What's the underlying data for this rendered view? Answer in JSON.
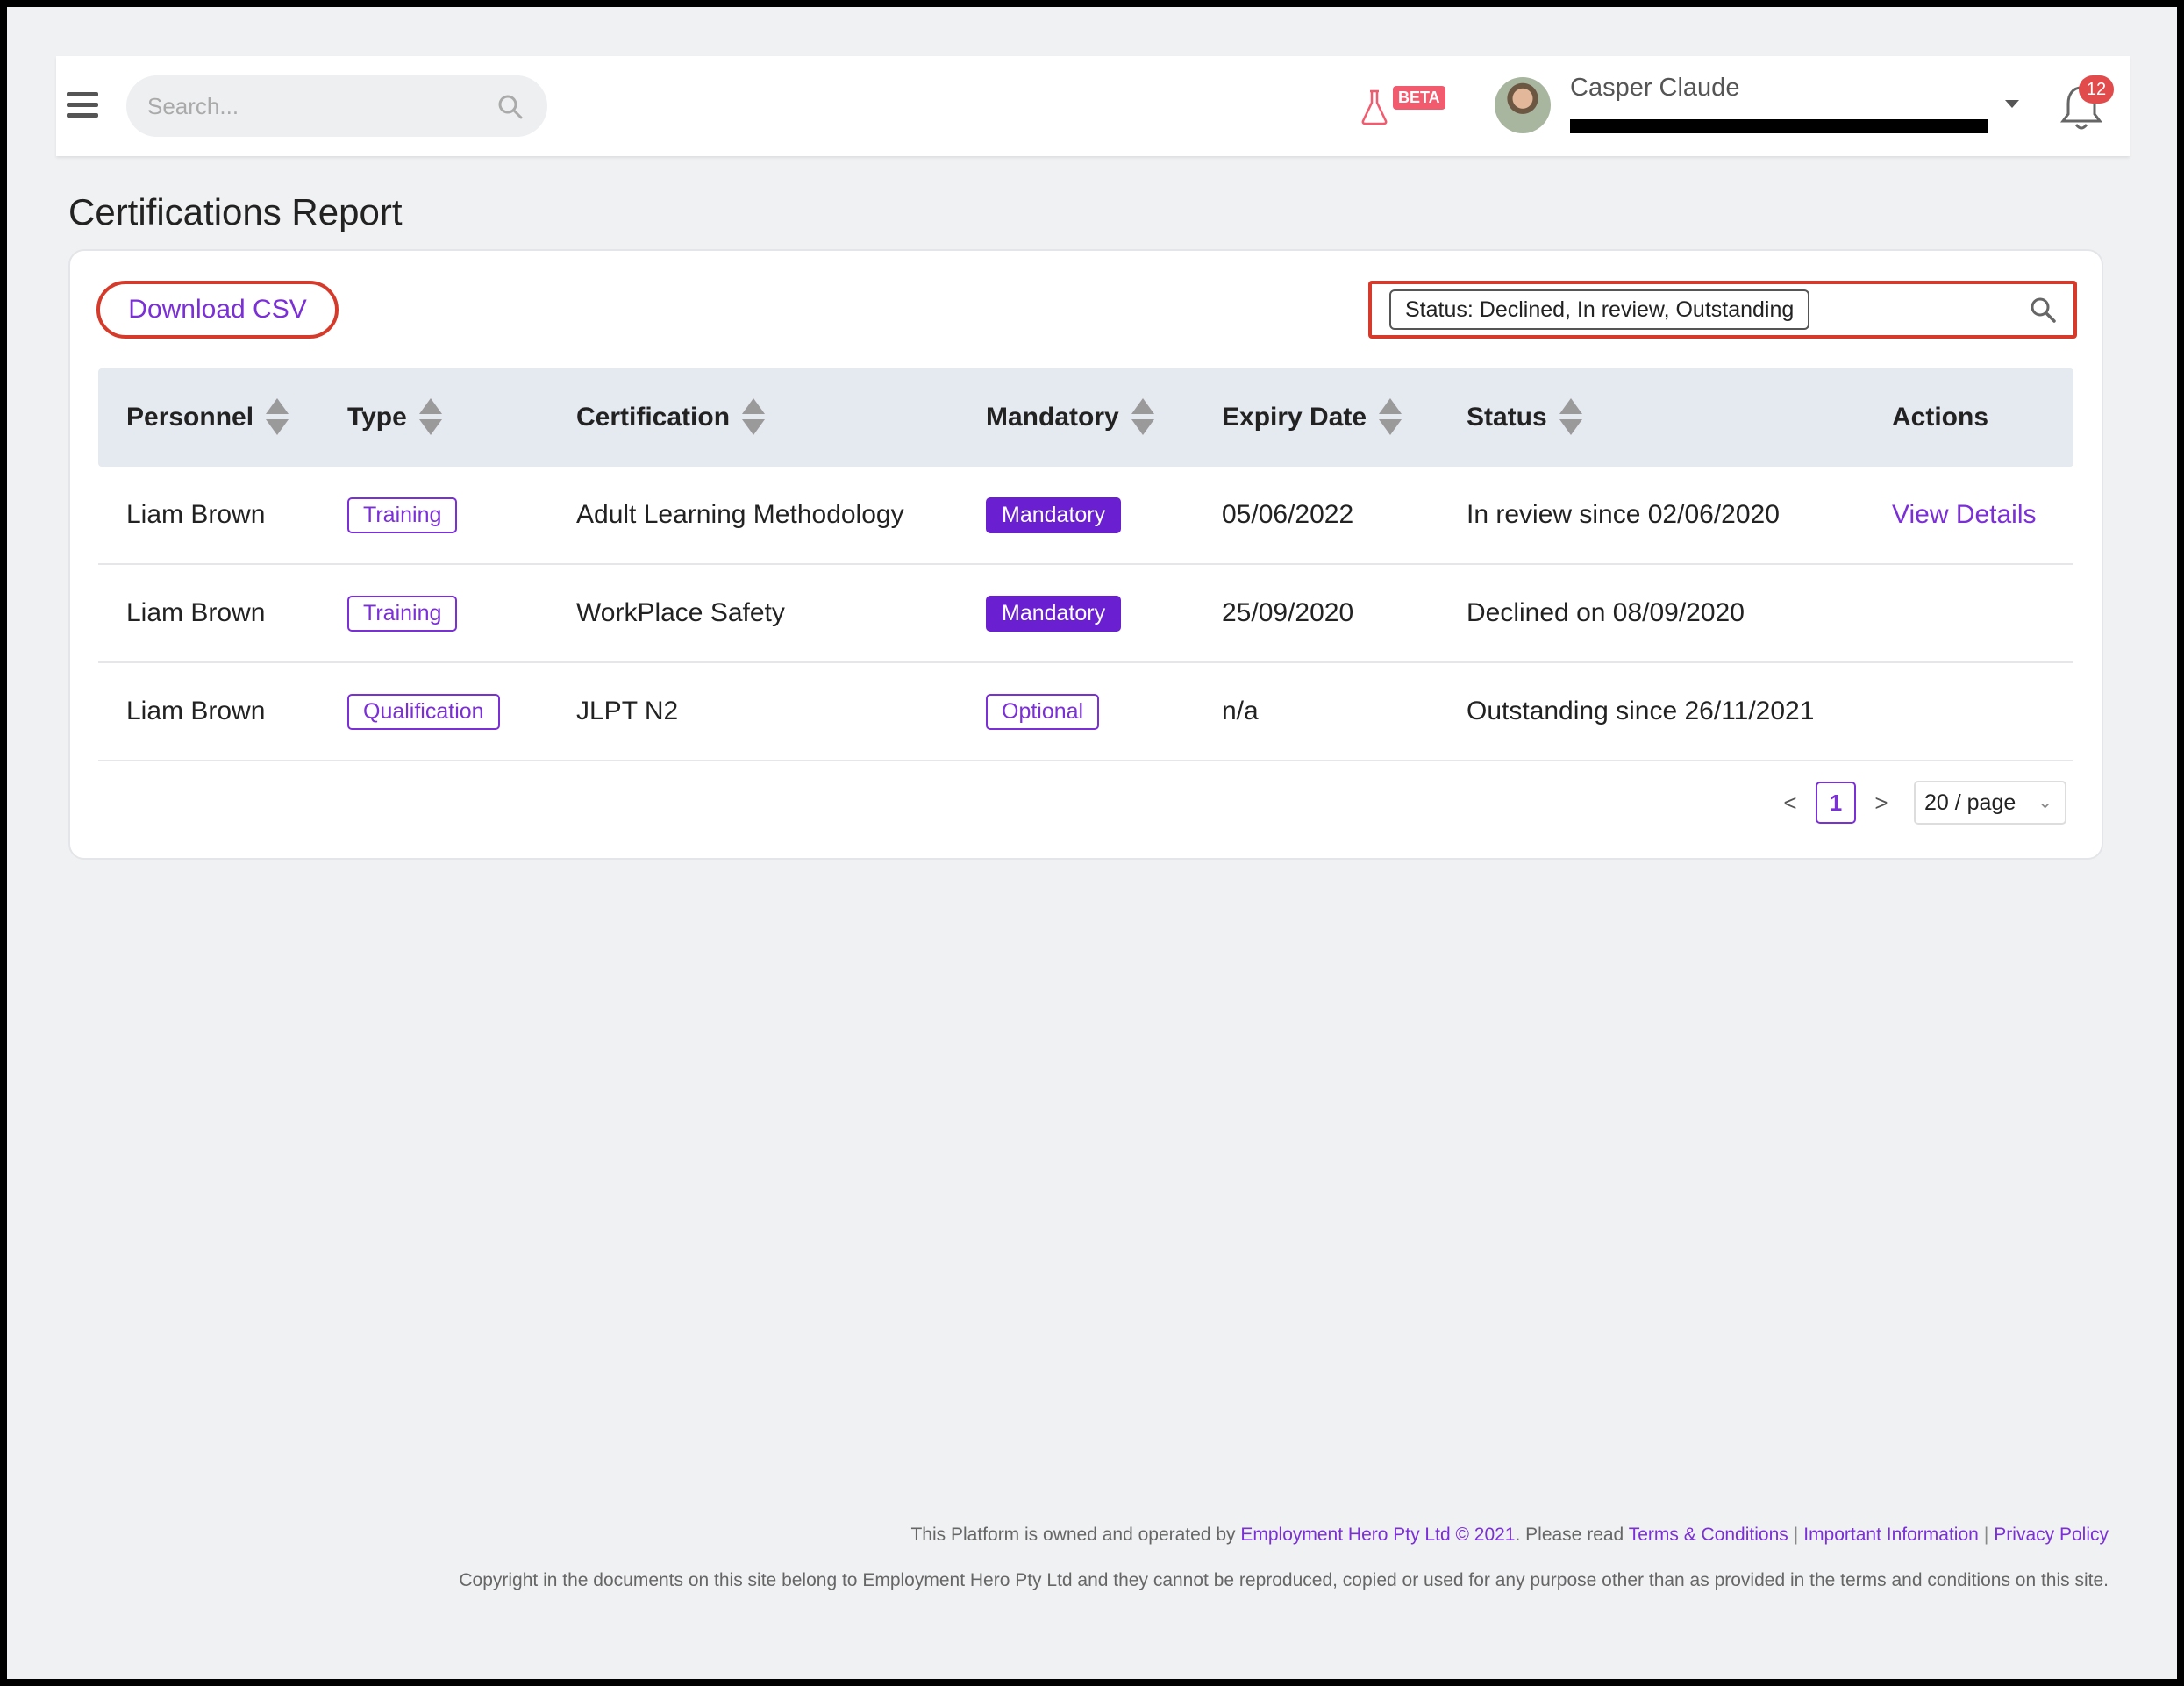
{
  "header": {
    "search_placeholder": "Search...",
    "beta_label": "BETA",
    "user_name": "Casper Claude",
    "notification_count": "12"
  },
  "page": {
    "title": "Certifications Report"
  },
  "toolbar": {
    "download_label": "Download CSV",
    "filter_chip": "Status: Declined, In review, Outstanding"
  },
  "table": {
    "headers": {
      "personnel": "Personnel",
      "type": "Type",
      "certification": "Certification",
      "mandatory": "Mandatory",
      "expiry": "Expiry Date",
      "status": "Status",
      "actions": "Actions"
    },
    "rows": [
      {
        "personnel": "Liam Brown",
        "type": "Training",
        "certification": "Adult Learning Methodology",
        "mandatory": "Mandatory",
        "expiry": "05/06/2022",
        "status": "In review since 02/06/2020",
        "action": "View Details"
      },
      {
        "personnel": "Liam Brown",
        "type": "Training",
        "certification": "WorkPlace Safety",
        "mandatory": "Mandatory",
        "expiry": "25/09/2020",
        "status": "Declined on 08/09/2020",
        "action": ""
      },
      {
        "personnel": "Liam Brown",
        "type": "Qualification",
        "certification": "JLPT N2",
        "mandatory": "Optional",
        "expiry": "n/a",
        "status": "Outstanding since 26/11/2021",
        "action": ""
      }
    ]
  },
  "pagination": {
    "prev": "<",
    "current_page": "1",
    "next": ">",
    "page_size": "20 / page"
  },
  "footer": {
    "line1_prefix": "This Platform is owned and operated by ",
    "company_link": "Employment Hero Pty Ltd © 2021",
    "line1_mid": ". Please read ",
    "terms_link": "Terms & Conditions",
    "important_link": "Important Information",
    "privacy_link": "Privacy Policy",
    "line2": "Copyright in the documents on this site belong to Employment Hero Pty Ltd and they cannot be reproduced, copied or used for any purpose other than as provided in the terms and conditions on this site."
  }
}
